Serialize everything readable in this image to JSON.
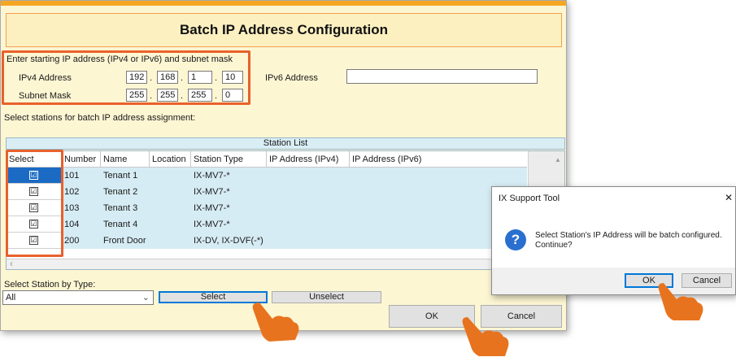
{
  "main": {
    "title": "Batch IP Address Configuration",
    "instruction": "Enter starting IP address (IPv4 or IPv6) and subnet mask",
    "ipv4_label": "IPv4 Address",
    "ipv4": [
      "192",
      "168",
      "1",
      "10"
    ],
    "subnet_label": "Subnet Mask",
    "subnet": [
      "255",
      "255",
      "255",
      "0"
    ],
    "ipv6_label": "IPv6 Address",
    "ipv6_value": "",
    "select_instruction": "Select stations for batch IP address assignment:",
    "station_list_title": "Station List",
    "columns": [
      "Select",
      "Number",
      "Name",
      "Location",
      "Station Type",
      "IP Address (IPv4)",
      "IP Address (IPv6)"
    ],
    "rows": [
      {
        "checked": "☑",
        "number": "101",
        "name": "Tenant 1",
        "location": "",
        "type": "IX-MV7-*",
        "ipv4": "",
        "ipv6": ""
      },
      {
        "checked": "☑",
        "number": "102",
        "name": "Tenant 2",
        "location": "",
        "type": "IX-MV7-*",
        "ipv4": "",
        "ipv6": ""
      },
      {
        "checked": "☑",
        "number": "103",
        "name": "Tenant 3",
        "location": "",
        "type": "IX-MV7-*",
        "ipv4": "",
        "ipv6": ""
      },
      {
        "checked": "☑",
        "number": "104",
        "name": "Tenant 4",
        "location": "",
        "type": "IX-MV7-*",
        "ipv4": "",
        "ipv6": ""
      },
      {
        "checked": "☑",
        "number": "200",
        "name": "Front Door",
        "location": "",
        "type": "IX-DV, IX-DVF(-*)",
        "ipv4": "",
        "ipv6": ""
      }
    ],
    "select_by_type_label": "Select Station by Type:",
    "type_selected": "All",
    "select_button": "Select",
    "unselect_button": "Unselect",
    "ok_button": "OK",
    "cancel_button": "Cancel"
  },
  "dialog": {
    "title": "IX Support Tool",
    "close": "✕",
    "message_line1": "Select Station's IP Address will be batch configured.",
    "message_line2": "Continue?",
    "ok_button": "OK",
    "cancel_button": "Cancel"
  },
  "icons": {
    "scroll_up": "▲",
    "scroll_left": "‹",
    "dropdown": "⌄",
    "question": "?"
  },
  "colors": {
    "highlight": "#e8612c",
    "accent_orange": "#f5a623",
    "window_bg": "#fdf6d3",
    "selected_row": "#1b6bc4",
    "hand": "#e8731e"
  }
}
